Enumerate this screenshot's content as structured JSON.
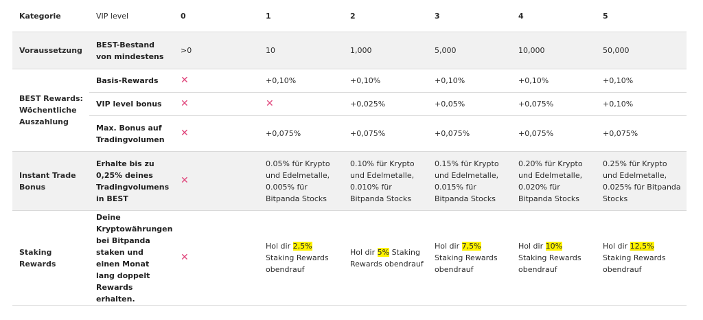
{
  "header": {
    "kategorie": "Kategorie",
    "vip_level": "VIP level",
    "levels": [
      "0",
      "1",
      "2",
      "3",
      "4",
      "5"
    ]
  },
  "rows": {
    "voraussetzung": {
      "category": "Voraussetzung",
      "label": "BEST-Bestand von mindestens",
      "values": [
        ">0",
        "10",
        "1,000",
        "5,000",
        "10,000",
        "50,000"
      ]
    },
    "best_rewards": {
      "category": "BEST Rewards: Wöchentliche Auszahlung",
      "basis": {
        "label": "Basis-Rewards",
        "values": [
          "+0,10%",
          "+0,10%",
          "+0,10%",
          "+0,10%",
          "+0,10%"
        ]
      },
      "vip_bonus": {
        "label": "VIP level bonus",
        "values": [
          "+0,025%",
          "+0,05%",
          "+0,075%",
          "+0,10%"
        ]
      },
      "max_bonus": {
        "label": "Max. Bonus auf Tradingvolumen",
        "values": [
          "+0,075%",
          "+0,075%",
          "+0,075%",
          "+0,075%",
          "+0,075%"
        ]
      }
    },
    "instant_trade": {
      "category": "Instant Trade Bonus",
      "label": "Erhalte bis zu 0,25% deines Tradingvolumens in BEST",
      "values": [
        "0.05% für Krypto und Edelmetalle, 0.005% für Bitpanda Stocks",
        "0.10% für Krypto und Edelmetalle, 0.010% für Bitpanda Stocks",
        "0.15% für Krypto und Edelmetalle, 0.015% für Bitpanda Stocks",
        "0.20% für Krypto und Edelmetalle, 0.020% für Bitpanda Stocks",
        "0.25% für Krypto und Edelmetalle, 0.025% für Bitpanda Stocks"
      ]
    },
    "staking": {
      "category": "Staking Rewards",
      "label": "Deine Kryptowährungen bei Bitpanda staken und einen Monat lang doppelt Rewards erhalten.",
      "prefix": "Hol dir",
      "suffix": "Staking Rewards obendrauf",
      "percents": [
        "2,5%",
        "5%",
        "7,5%",
        "10%",
        "12,5%"
      ]
    }
  },
  "cross_symbol": "✕",
  "colors": {
    "cross": "#e0457b",
    "highlight": "#fff200",
    "row_grey": "#f1f1f1"
  }
}
